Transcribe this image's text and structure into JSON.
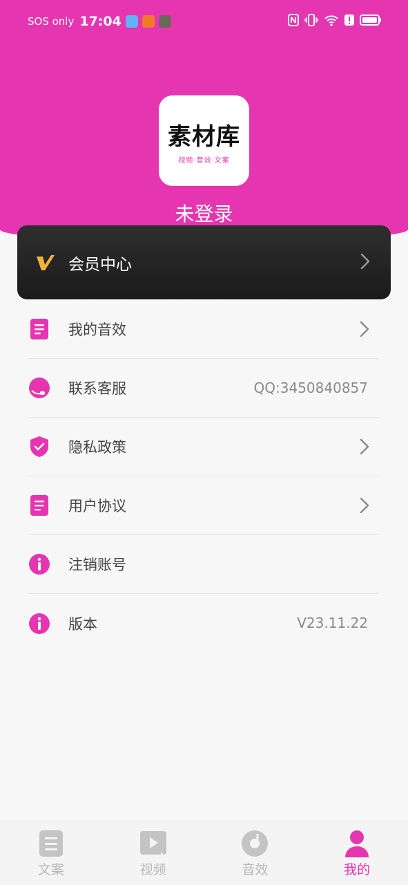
{
  "status_bar": {
    "sos": "SOS only",
    "time": "17:04"
  },
  "profile": {
    "logo_title": "素材库",
    "logo_subtitle": "视频·音效·文案",
    "login_status": "未登录"
  },
  "vip": {
    "label": "会员中心"
  },
  "menu": [
    {
      "label": "我的音效",
      "icon": "document-icon"
    },
    {
      "label": "联系客服",
      "icon": "headset-icon",
      "value": "QQ:3450840857"
    },
    {
      "label": "隐私政策",
      "icon": "shield-check-icon"
    },
    {
      "label": "用户协议",
      "icon": "document-icon"
    },
    {
      "label": "注销账号",
      "icon": "info-icon"
    },
    {
      "label": "版本",
      "icon": "info-icon",
      "value": "V23.11.22"
    }
  ],
  "tabs": [
    {
      "label": "文案",
      "icon": "document-icon"
    },
    {
      "label": "视频",
      "icon": "video-icon"
    },
    {
      "label": "音效",
      "icon": "music-disc-icon"
    },
    {
      "label": "我的",
      "icon": "person-icon",
      "active": true
    }
  ],
  "colors": {
    "accent": "#e535b0",
    "vip_gold": "#f0b23a",
    "tab_inactive": "#b8b8b8"
  }
}
